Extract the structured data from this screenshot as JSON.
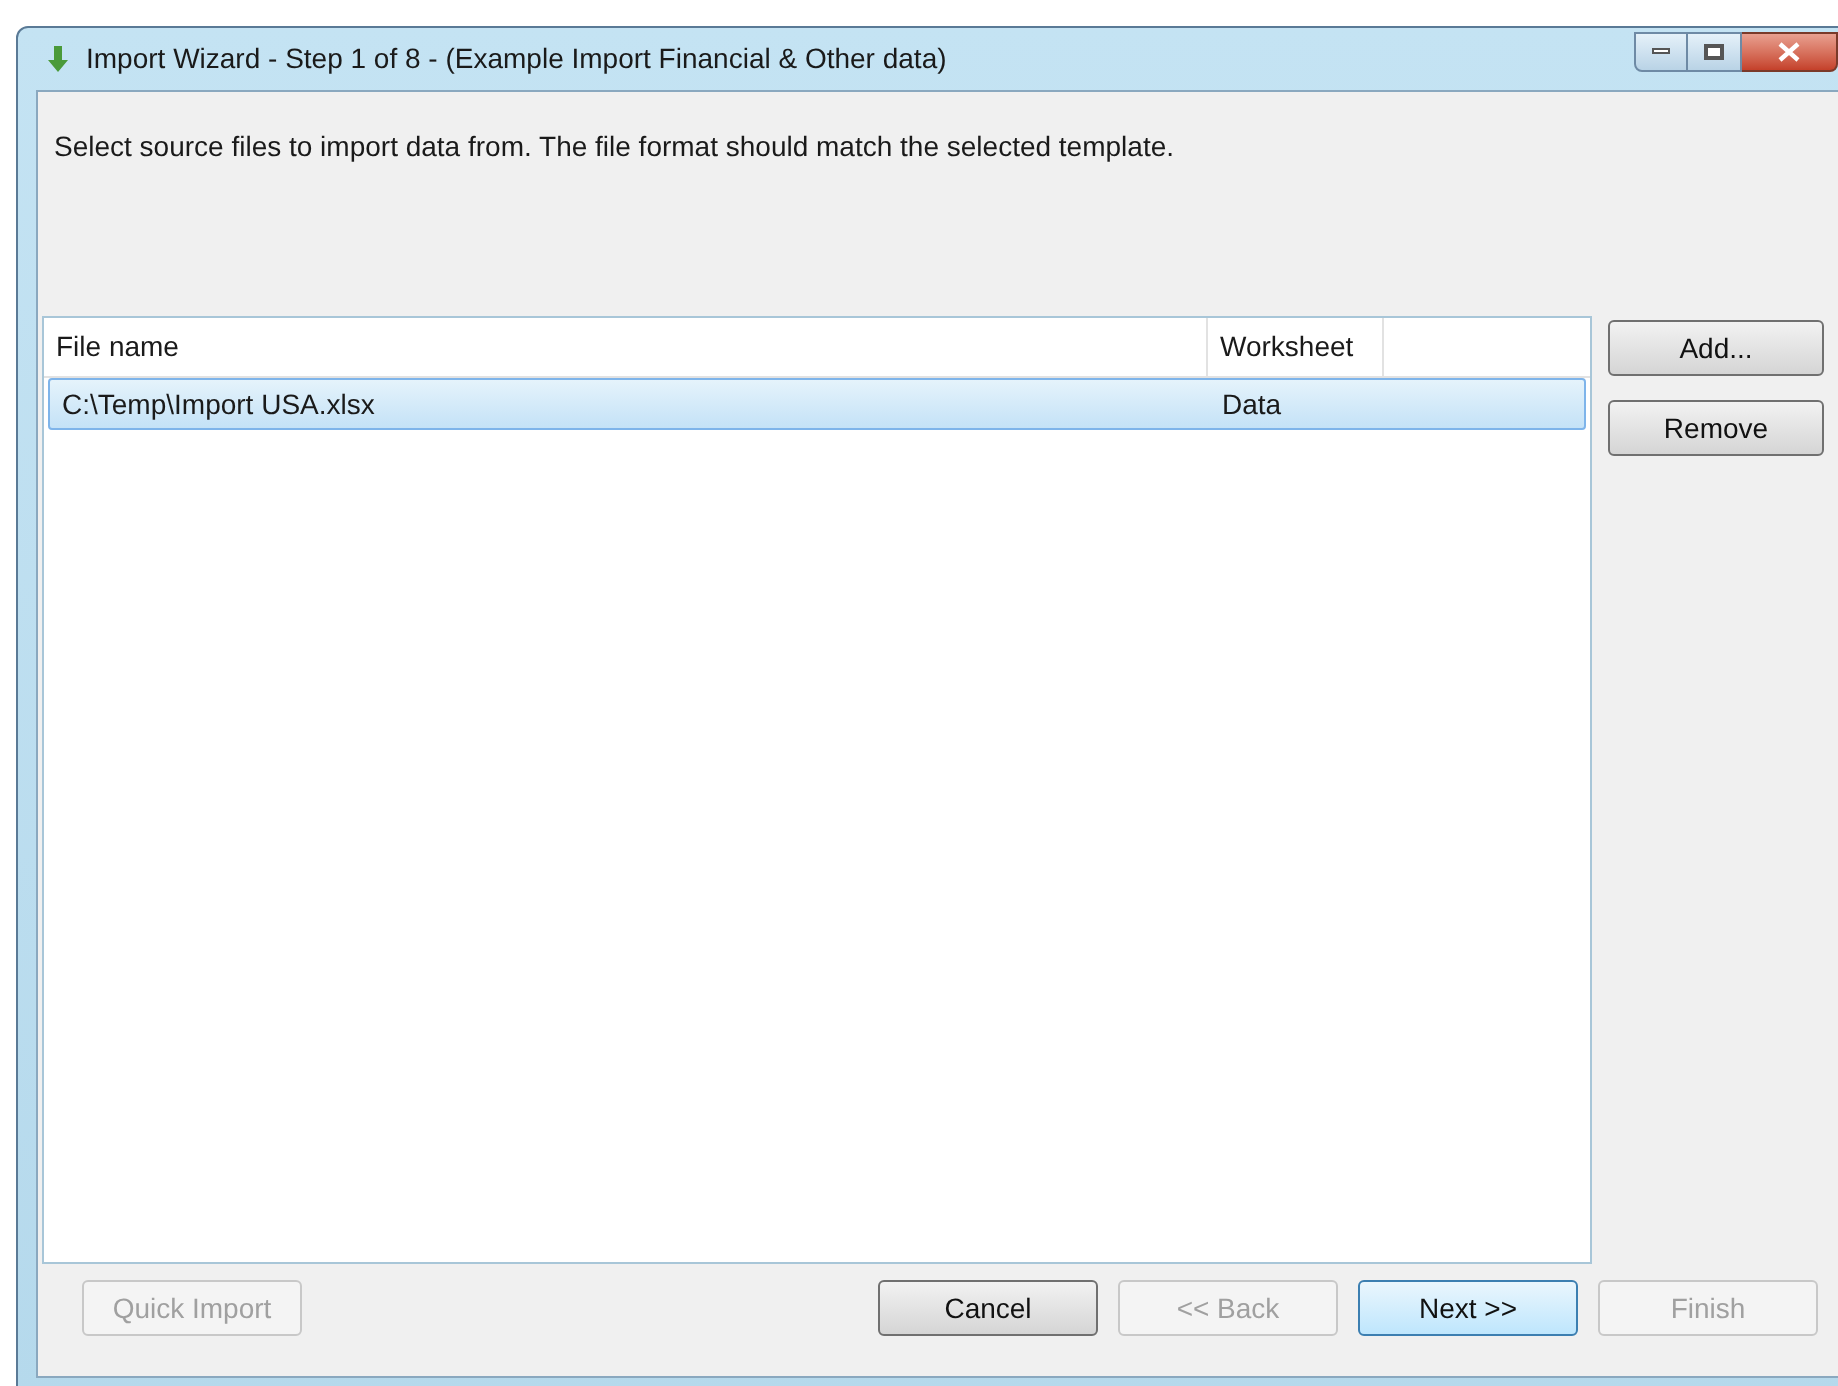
{
  "window": {
    "title": "Import Wizard - Step 1 of 8 - (Example Import Financial & Other data)"
  },
  "instruction": "Select source files to import data from. The file format should match the selected template.",
  "table": {
    "columns": [
      "File name",
      "Worksheet"
    ],
    "rows": [
      {
        "cells": [
          "C:\\Temp\\Import USA.xlsx",
          "Data"
        ],
        "selected": true
      }
    ]
  },
  "side_buttons": [
    {
      "label": "Add...",
      "disabled": false
    },
    {
      "label": "Remove",
      "disabled": false
    }
  ],
  "bottom_buttons": [
    {
      "label": "Quick Import",
      "disabled": true,
      "default": false
    },
    {
      "label": "Cancel",
      "disabled": false,
      "default": false
    },
    {
      "label": "<< Back",
      "disabled": true,
      "default": false
    },
    {
      "label": "Next >>",
      "disabled": false,
      "default": true
    },
    {
      "label": "Finish",
      "disabled": true,
      "default": false
    }
  ]
}
